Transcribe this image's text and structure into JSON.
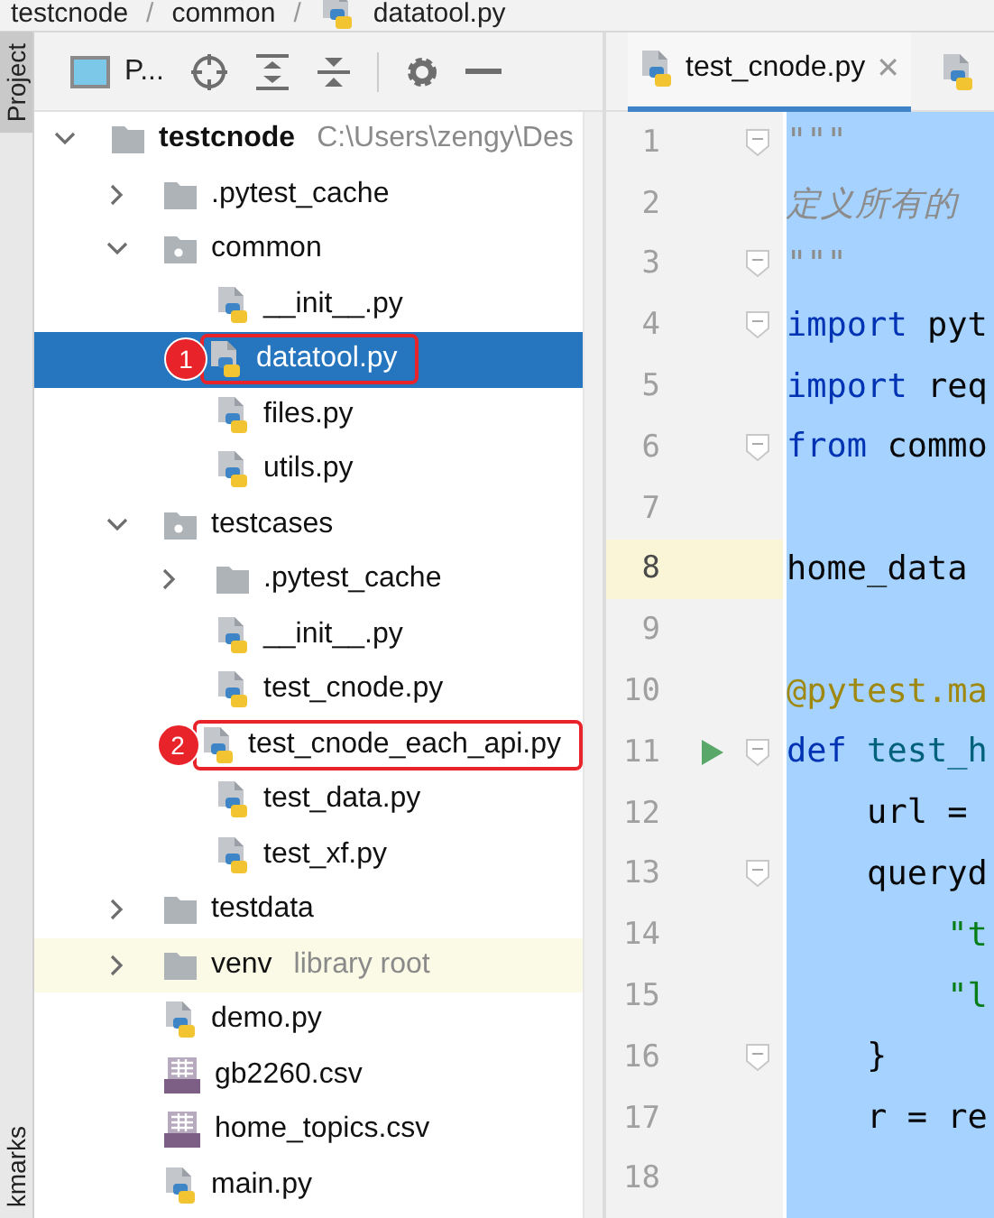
{
  "breadcrumb": [
    "testcnode",
    "common",
    "datatool.py"
  ],
  "breadcrumb_separator": "/",
  "side_strip": {
    "top_tab": "Project",
    "bottom_tab": "kmarks"
  },
  "project_panel": {
    "title": "P...",
    "tree": [
      {
        "name": "testcnode",
        "kind": "folder",
        "hint": "C:\\Users\\zengy\\Des",
        "expanded": true,
        "selected": false,
        "children": [
          {
            "name": ".pytest_cache",
            "kind": "folder",
            "expanded": false,
            "selected": false
          },
          {
            "name": "common",
            "kind": "package",
            "expanded": true,
            "selected": false,
            "children": [
              {
                "name": "__init__.py",
                "kind": "python",
                "selected": false
              },
              {
                "name": "datatool.py",
                "kind": "python",
                "selected": true,
                "callout": "1"
              },
              {
                "name": "files.py",
                "kind": "python",
                "selected": false
              },
              {
                "name": "utils.py",
                "kind": "python",
                "selected": false
              }
            ]
          },
          {
            "name": "testcases",
            "kind": "package",
            "expanded": true,
            "selected": false,
            "children": [
              {
                "name": ".pytest_cache",
                "kind": "folder",
                "expanded": false,
                "selected": false
              },
              {
                "name": "__init__.py",
                "kind": "python",
                "selected": false
              },
              {
                "name": "test_cnode.py",
                "kind": "python",
                "selected": false
              },
              {
                "name": "test_cnode_each_api.py",
                "kind": "python",
                "selected": false,
                "callout": "2"
              },
              {
                "name": "test_data.py",
                "kind": "python",
                "selected": false
              },
              {
                "name": "test_xf.py",
                "kind": "python",
                "selected": false
              }
            ]
          },
          {
            "name": "testdata",
            "kind": "folder",
            "expanded": false,
            "selected": false
          },
          {
            "name": "venv",
            "kind": "library",
            "hint": "library root",
            "expanded": false,
            "selected": false
          },
          {
            "name": "demo.py",
            "kind": "python",
            "selected": false
          },
          {
            "name": "gb2260.csv",
            "kind": "csv",
            "selected": false
          },
          {
            "name": "home_topics.csv",
            "kind": "csv",
            "selected": false
          },
          {
            "name": "main.py",
            "kind": "python",
            "selected": false
          }
        ]
      }
    ]
  },
  "editor": {
    "tabs": [
      {
        "label": "test_cnode.py",
        "selected": true,
        "close": "✕"
      },
      {
        "selected": false
      }
    ],
    "lines": [
      {
        "number": "1",
        "fold": true,
        "run": false,
        "current": false,
        "tokens": [
          {
            "text": "\"\"\"",
            "kind": "doc"
          }
        ]
      },
      {
        "number": "2",
        "fold": false,
        "run": false,
        "current": false,
        "tokens": [
          {
            "text": "定义所有的",
            "kind": "doc"
          }
        ]
      },
      {
        "number": "3",
        "fold": true,
        "run": false,
        "current": false,
        "tokens": [
          {
            "text": "\"\"\"",
            "kind": "doc"
          }
        ]
      },
      {
        "number": "4",
        "fold": true,
        "run": false,
        "current": false,
        "tokens": [
          {
            "text": "import",
            "kind": "keyword"
          },
          {
            "text": " pyt",
            "kind": "plain"
          }
        ]
      },
      {
        "number": "5",
        "fold": false,
        "run": false,
        "current": false,
        "tokens": [
          {
            "text": "import",
            "kind": "keyword"
          },
          {
            "text": " req",
            "kind": "plain"
          }
        ]
      },
      {
        "number": "6",
        "fold": true,
        "run": false,
        "current": false,
        "tokens": [
          {
            "text": "from",
            "kind": "keyword"
          },
          {
            "text": " commo",
            "kind": "plain"
          }
        ]
      },
      {
        "number": "7",
        "fold": false,
        "run": false,
        "current": false
      },
      {
        "number": "8",
        "fold": false,
        "run": false,
        "current": true,
        "tokens": [
          {
            "text": "home_data",
            "kind": "plain"
          }
        ]
      },
      {
        "number": "9",
        "fold": false,
        "run": false,
        "current": false
      },
      {
        "number": "10",
        "fold": false,
        "run": false,
        "current": false,
        "tokens": [
          {
            "text": "@pytest.ma",
            "kind": "decorator"
          }
        ]
      },
      {
        "number": "11",
        "fold": true,
        "run": true,
        "current": false,
        "tokens": [
          {
            "text": "def",
            "kind": "keyword"
          },
          {
            "text": " test_h",
            "kind": "function"
          }
        ]
      },
      {
        "number": "12",
        "fold": false,
        "run": false,
        "current": false,
        "tokens": [
          {
            "text": "    url =",
            "kind": "plain"
          }
        ]
      },
      {
        "number": "13",
        "fold": true,
        "run": false,
        "current": false,
        "tokens": [
          {
            "text": "    queryd",
            "kind": "plain"
          }
        ]
      },
      {
        "number": "14",
        "fold": false,
        "run": false,
        "current": false,
        "tokens": [
          {
            "text": "        \"t",
            "kind": "string"
          }
        ]
      },
      {
        "number": "15",
        "fold": false,
        "run": false,
        "current": false,
        "tokens": [
          {
            "text": "        \"l",
            "kind": "string"
          }
        ]
      },
      {
        "number": "16",
        "fold": true,
        "run": false,
        "current": false,
        "tokens": [
          {
            "text": "    }",
            "kind": "plain"
          }
        ]
      },
      {
        "number": "17",
        "fold": false,
        "run": false,
        "current": false,
        "tokens": [
          {
            "text": "    r = re",
            "kind": "plain"
          }
        ]
      },
      {
        "number": "18",
        "fold": false,
        "run": false,
        "current": false
      }
    ]
  }
}
